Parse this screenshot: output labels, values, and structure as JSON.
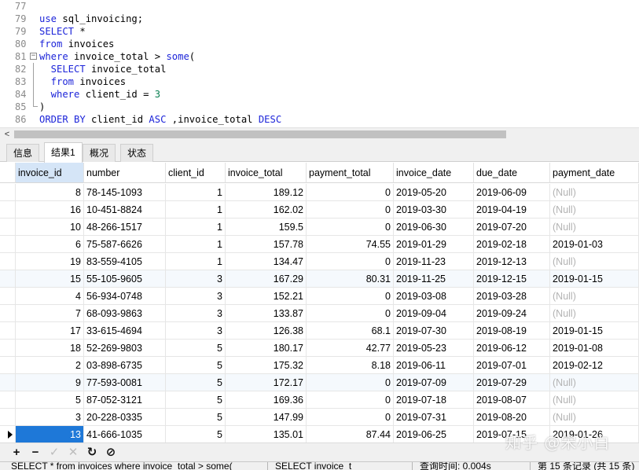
{
  "editor": {
    "lines": [
      {
        "n": "77",
        "tokens": []
      },
      {
        "n": "79",
        "tokens": [
          {
            "t": "use",
            "c": "kw"
          },
          {
            "t": " sql_invoicing;",
            "c": "id"
          }
        ]
      },
      {
        "n": "79",
        "tokens": [
          {
            "t": "SELECT",
            "c": "kw"
          },
          {
            "t": " *",
            "c": "id"
          }
        ]
      },
      {
        "n": "80",
        "tokens": [
          {
            "t": "from",
            "c": "kw"
          },
          {
            "t": " invoices",
            "c": "id"
          }
        ]
      },
      {
        "n": "81",
        "fold": "−",
        "tokens": [
          {
            "t": "where",
            "c": "kw"
          },
          {
            "t": " invoice_total > ",
            "c": "id"
          },
          {
            "t": "some",
            "c": "kw"
          },
          {
            "t": "(",
            "c": "id"
          }
        ]
      },
      {
        "n": "82",
        "tokens": [
          {
            "t": "  SELECT",
            "c": "kw"
          },
          {
            "t": " invoice_total",
            "c": "id"
          }
        ]
      },
      {
        "n": "83",
        "tokens": [
          {
            "t": "  from",
            "c": "kw"
          },
          {
            "t": " invoices",
            "c": "id"
          }
        ]
      },
      {
        "n": "84",
        "tokens": [
          {
            "t": "  where",
            "c": "kw"
          },
          {
            "t": " client_id = ",
            "c": "id"
          },
          {
            "t": "3",
            "c": "num"
          }
        ]
      },
      {
        "n": "85",
        "tokens": [
          {
            "t": ")",
            "c": "id"
          }
        ]
      },
      {
        "n": "86",
        "tokens": [
          {
            "t": "ORDER BY",
            "c": "kw"
          },
          {
            "t": " client_id ",
            "c": "id"
          },
          {
            "t": "ASC",
            "c": "kw"
          },
          {
            "t": " ,invoice_total ",
            "c": "id"
          },
          {
            "t": "DESC",
            "c": "kw"
          }
        ]
      }
    ]
  },
  "scrollbar": {
    "left_arrow": "<"
  },
  "tabs": [
    {
      "label": "信息",
      "active": false
    },
    {
      "label": "结果1",
      "active": true
    },
    {
      "label": "概况",
      "active": false
    },
    {
      "label": "状态",
      "active": false
    }
  ],
  "grid": {
    "columns": [
      "invoice_id",
      "number",
      "client_id",
      "invoice_total",
      "payment_total",
      "invoice_date",
      "due_date",
      "payment_date"
    ],
    "rows": [
      [
        "8",
        "78-145-1093",
        "1",
        "189.12",
        "0",
        "2019-05-20",
        "2019-06-09",
        "(Null)"
      ],
      [
        "16",
        "10-451-8824",
        "1",
        "162.02",
        "0",
        "2019-03-30",
        "2019-04-19",
        "(Null)"
      ],
      [
        "10",
        "48-266-1517",
        "1",
        "159.5",
        "0",
        "2019-06-30",
        "2019-07-20",
        "(Null)"
      ],
      [
        "6",
        "75-587-6626",
        "1",
        "157.78",
        "74.55",
        "2019-01-29",
        "2019-02-18",
        "2019-01-03"
      ],
      [
        "19",
        "83-559-4105",
        "1",
        "134.47",
        "0",
        "2019-11-23",
        "2019-12-13",
        "(Null)"
      ],
      [
        "15",
        "55-105-9605",
        "3",
        "167.29",
        "80.31",
        "2019-11-25",
        "2019-12-15",
        "2019-01-15"
      ],
      [
        "4",
        "56-934-0748",
        "3",
        "152.21",
        "0",
        "2019-03-08",
        "2019-03-28",
        "(Null)"
      ],
      [
        "7",
        "68-093-9863",
        "3",
        "133.87",
        "0",
        "2019-09-04",
        "2019-09-24",
        "(Null)"
      ],
      [
        "17",
        "33-615-4694",
        "3",
        "126.38",
        "68.1",
        "2019-07-30",
        "2019-08-19",
        "2019-01-15"
      ],
      [
        "18",
        "52-269-9803",
        "5",
        "180.17",
        "42.77",
        "2019-05-23",
        "2019-06-12",
        "2019-01-08"
      ],
      [
        "2",
        "03-898-6735",
        "5",
        "175.32",
        "8.18",
        "2019-06-11",
        "2019-07-01",
        "2019-02-12"
      ],
      [
        "9",
        "77-593-0081",
        "5",
        "172.17",
        "0",
        "2019-07-09",
        "2019-07-29",
        "(Null)"
      ],
      [
        "5",
        "87-052-3121",
        "5",
        "169.36",
        "0",
        "2019-07-18",
        "2019-08-07",
        "(Null)"
      ],
      [
        "3",
        "20-228-0335",
        "5",
        "147.99",
        "0",
        "2019-07-31",
        "2019-08-20",
        "(Null)"
      ],
      [
        "13",
        "41-666-1035",
        "5",
        "135.01",
        "87.44",
        "2019-06-25",
        "2019-07-15",
        "2019-01-26"
      ]
    ],
    "null_text": "(Null)"
  },
  "toolbar": {
    "add": "+",
    "delete": "−",
    "apply": "✓",
    "discard": "✕",
    "refresh": "↻",
    "stop": "⊘"
  },
  "status": {
    "query1": "SELECT * from invoices where invoice_total > some(",
    "query2": "SELECT invoice_t",
    "time": "查询时间: 0.004s",
    "records": "第 15 条记录 (共 15 条)"
  },
  "watermark": "知乎 @宋小白",
  "colors": {
    "keyword": "#1c24d9",
    "number": "#0a7f52",
    "selection": "#1e78d8",
    "header_selected": "#d5e5f7",
    "null": "#b3b3b3"
  }
}
